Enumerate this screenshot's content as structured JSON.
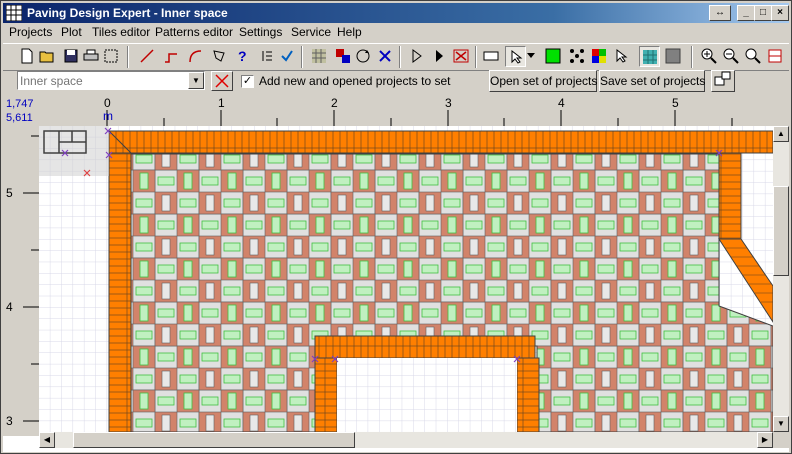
{
  "window": {
    "title": "Paving Design Expert - Inner space",
    "controls": {
      "restore": "↔",
      "minimize": "_",
      "maximize": "□",
      "close": "×"
    }
  },
  "menu": [
    "Projects",
    "Plot",
    "Tiles editor",
    "Patterns editor",
    "Settings",
    "Service",
    "Help"
  ],
  "toolbar_icons": [
    "new-icon",
    "open-icon",
    "save-icon",
    "print-icon",
    "select-area-icon",
    "line-icon",
    "polyline-icon",
    "arc-icon",
    "polygon-icon",
    "help-cursor-icon",
    "numbering-icon",
    "check-icon",
    "grid-icon",
    "fill-icon",
    "rotate-icon",
    "delete-icon",
    "play-marker-icon",
    "play-icon",
    "cancel-icon",
    "tile-icon",
    "pointer-icon",
    "fill-green-icon",
    "points-icon",
    "palette-icon",
    "pointer2-icon",
    "texture-icon",
    "gray-fill-icon",
    "zoom-in-icon",
    "zoom-out-icon",
    "zoom-fit-icon",
    "zoom-page-icon"
  ],
  "setbar": {
    "project_placeholder": "Inner space",
    "checkbox_label": "Add new and opened projects to set",
    "checkbox_checked": true,
    "open_set": "Open set of projects",
    "save_set": "Save set of projects"
  },
  "ruler": {
    "coord_x": "1,747",
    "coord_y": "5,611",
    "unit": "m",
    "h_ticks": [
      "0",
      "1",
      "2",
      "3",
      "4",
      "5"
    ],
    "v_ticks": [
      "5",
      "4",
      "3"
    ]
  },
  "colors": {
    "border_orange": "#ff7f00",
    "tile_brown": "#d2836a",
    "tile_green": "#c0f0c0",
    "tile_gray": "#e0e0e0",
    "grid": "#d8d8e8",
    "marker": "#8040c0"
  }
}
